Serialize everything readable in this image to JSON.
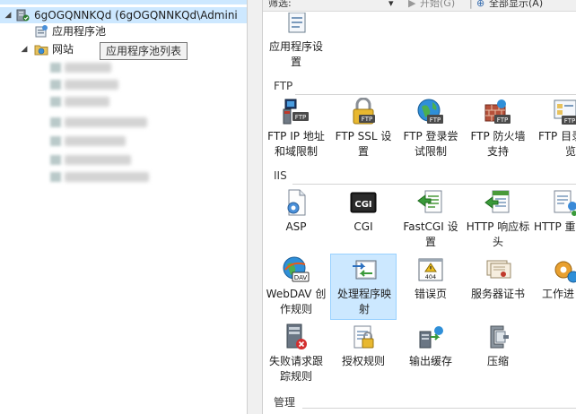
{
  "tree": {
    "server_label": "6gOGQNNKQd (6gOGQNNKQd\\Admini",
    "app_pools_label": "应用程序池",
    "sites_label": "网站",
    "tooltip": "应用程序池列表"
  },
  "filter_bar": {
    "filter_label": "筛选:",
    "go_label": "开始(G)",
    "show_all_label": "全部显示(A)"
  },
  "sections": {
    "ftp": "FTP",
    "iis": "IIS",
    "management": "管理"
  },
  "features": {
    "app_settings": [
      "应用程序设",
      "置"
    ],
    "ftp_ip": [
      "FTP IP 地址",
      "和域限制"
    ],
    "ftp_ssl": [
      "FTP SSL 设",
      "置"
    ],
    "ftp_logon": [
      "FTP 登录尝",
      "试限制"
    ],
    "ftp_firewall": [
      "FTP 防火墙",
      "支持"
    ],
    "ftp_dir": [
      "FTP 目录",
      "览"
    ],
    "asp": [
      "ASP"
    ],
    "cgi": [
      "CGI"
    ],
    "fastcgi": [
      "FastCGI 设",
      "置"
    ],
    "http_headers": [
      "HTTP 响应标",
      "头"
    ],
    "http_redirect": [
      "HTTP 重"
    ],
    "webdav": [
      "WebDAV 创",
      "作规则"
    ],
    "handler": [
      "处理程序映",
      "射"
    ],
    "error_pages": [
      "错误页"
    ],
    "server_cert": [
      "服务器证书"
    ],
    "worker": [
      "工作进"
    ],
    "failed_req": [
      "失败请求跟",
      "踪规则"
    ],
    "authz": [
      "授权规则"
    ],
    "output_cache": [
      "输出缓存"
    ],
    "compression": [
      "压缩"
    ]
  },
  "icon_text": {
    "ftp_badge": "FTP",
    "cgi_badge": "CGI",
    "dav_badge": "DAV",
    "error_code": "404"
  },
  "colors": {
    "selection": "#cce8ff",
    "selection_border": "#99d1ff",
    "tree_selection": "#cde8ff"
  }
}
